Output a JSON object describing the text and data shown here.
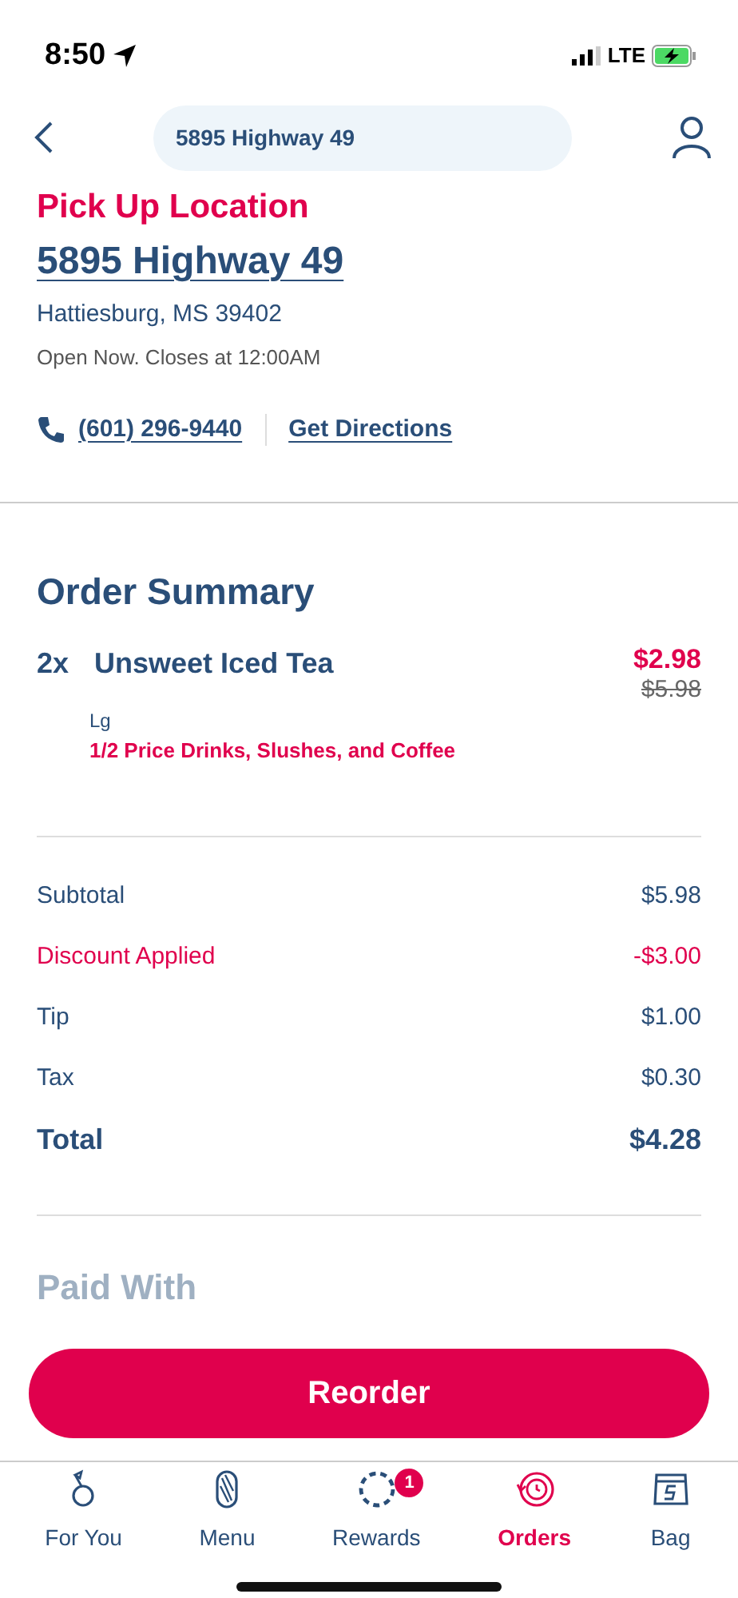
{
  "status_bar": {
    "time": "8:50",
    "network": "LTE"
  },
  "header": {
    "title": "5895 Highway 49"
  },
  "location": {
    "heading": "Pick Up Location",
    "address": "5895 Highway 49",
    "city": "Hattiesburg, MS 39402",
    "hours": "Open Now. Closes at 12:00AM",
    "phone": "(601) 296-9440",
    "directions": "Get Directions"
  },
  "order_summary": {
    "title": "Order Summary",
    "items": [
      {
        "quantity": "2x",
        "name": "Unsweet Iced Tea",
        "price": "$2.98",
        "original_price": "$5.98",
        "size": "Lg",
        "promotion": "1/2 Price Drinks, Slushes, and Coffee"
      }
    ]
  },
  "totals": [
    {
      "kind": "normal",
      "label": "Subtotal",
      "value": "$5.98"
    },
    {
      "kind": "discount",
      "label": "Discount Applied",
      "value": "-$3.00"
    },
    {
      "kind": "normal",
      "label": "Tip",
      "value": "$1.00"
    },
    {
      "kind": "normal",
      "label": "Tax",
      "value": "$0.30"
    },
    {
      "kind": "total",
      "label": "Total",
      "value": "$4.28"
    }
  ],
  "paid_with": {
    "title": "Paid With"
  },
  "reorder_button": "Reorder",
  "tabs": [
    {
      "kind": "foryou",
      "label": "For You",
      "selected": false
    },
    {
      "kind": "menu",
      "label": "Menu",
      "selected": false
    },
    {
      "kind": "rewards",
      "label": "Rewards",
      "selected": false,
      "badge": "1"
    },
    {
      "kind": "orders",
      "label": "Orders",
      "selected": true
    },
    {
      "kind": "bag",
      "label": "Bag",
      "selected": false
    }
  ]
}
